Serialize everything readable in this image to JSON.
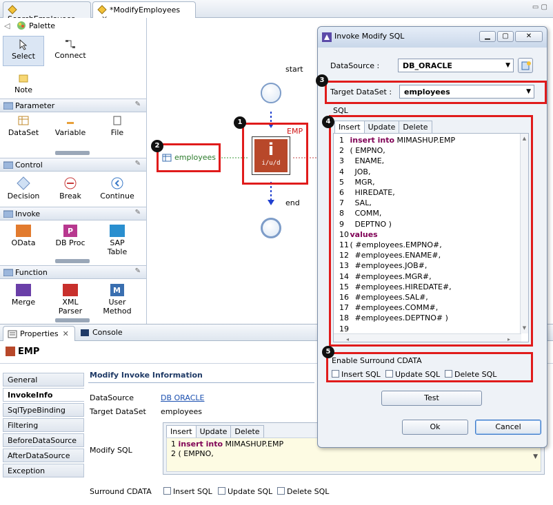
{
  "editor_tabs": [
    {
      "label": "SearchEmployees"
    },
    {
      "label": "*ModifyEmployees"
    }
  ],
  "palette": {
    "title": "Palette",
    "tools": [
      "Select",
      "Connect",
      "Note"
    ],
    "sections": [
      {
        "title": "Parameter",
        "items": [
          "DataSet",
          "Variable",
          "File"
        ]
      },
      {
        "title": "Control",
        "items": [
          "Decision",
          "Break",
          "Continue"
        ]
      },
      {
        "title": "Invoke",
        "items": [
          "OData",
          "DB Proc",
          "SAP\nTable"
        ]
      },
      {
        "title": "Function",
        "items": [
          "Merge",
          "XML\nParser",
          "User\nMethod"
        ]
      }
    ]
  },
  "canvas": {
    "start_label": "start",
    "end_label": "end",
    "node_label": "EMP",
    "node_caption": "i/u/d",
    "dataset_label": "employees",
    "badges": [
      "1",
      "2",
      "3",
      "4",
      "5"
    ]
  },
  "dialog": {
    "title": "Invoke Modify SQL",
    "datasource_label": "DataSource :",
    "datasource_value": "DB_ORACLE",
    "target_label": "Target DataSet :",
    "target_value": "employees",
    "sql_group": "SQL",
    "tabs": [
      "Insert",
      "Update",
      "Delete"
    ],
    "sql_lines": [
      {
        "n": "1",
        "kw": "insert into",
        "text": " MIMASHUP.EMP"
      },
      {
        "n": "2",
        "kw": "",
        "text": "( EMPNO,"
      },
      {
        "n": "3",
        "kw": "",
        "text": "  ENAME,"
      },
      {
        "n": "4",
        "kw": "",
        "text": "  JOB,"
      },
      {
        "n": "5",
        "kw": "",
        "text": "  MGR,"
      },
      {
        "n": "6",
        "kw": "",
        "text": "  HIREDATE,"
      },
      {
        "n": "7",
        "kw": "",
        "text": "  SAL,"
      },
      {
        "n": "8",
        "kw": "",
        "text": "  COMM,"
      },
      {
        "n": "9",
        "kw": "",
        "text": "  DEPTNO )"
      },
      {
        "n": "10",
        "kw": "values",
        "text": ""
      },
      {
        "n": "11",
        "kw": "",
        "text": "( #employees.EMPNO#,"
      },
      {
        "n": "12",
        "kw": "",
        "text": "  #employees.ENAME#,"
      },
      {
        "n": "13",
        "kw": "",
        "text": "  #employees.JOB#,"
      },
      {
        "n": "14",
        "kw": "",
        "text": "  #employees.MGR#,"
      },
      {
        "n": "15",
        "kw": "",
        "text": "  #employees.HIREDATE#,"
      },
      {
        "n": "16",
        "kw": "",
        "text": "  #employees.SAL#,"
      },
      {
        "n": "17",
        "kw": "",
        "text": "  #employees.COMM#,"
      },
      {
        "n": "18",
        "kw": "",
        "text": "  #employees.DEPTNO# )"
      },
      {
        "n": "19",
        "kw": "",
        "text": ""
      }
    ],
    "cdata_group": "Enable Surround CDATA",
    "cdata_options": [
      "Insert SQL",
      "Update SQL",
      "Delete SQL"
    ],
    "test_button": "Test",
    "ok_button": "Ok",
    "cancel_button": "Cancel"
  },
  "properties": {
    "tabs": [
      "Properties",
      "Console"
    ],
    "heading": "EMP",
    "side_tabs": [
      "General",
      "InvokeInfo",
      "SqlTypeBinding",
      "Filtering",
      "BeforeDataSource",
      "AfterDataSource",
      "Exception"
    ],
    "section_title": "Modify Invoke Information",
    "datasource_label": "DataSource",
    "datasource_value": "DB ORACLE",
    "target_label": "Target DataSet",
    "target_value": "employees",
    "modify_sql_label": "Modify SQL",
    "sql_tabs": [
      "Insert",
      "Update",
      "Delete"
    ],
    "sql_line1_kw": "insert into",
    "sql_line1_text": " MIMASHUP.EMP",
    "sql_line2_text": "( EMPNO,",
    "cdata_label": "Surround CDATA",
    "cdata_options": [
      "Insert SQL",
      "Update SQL",
      "Delete SQL"
    ]
  },
  "colors": {
    "highlight": "#e01b1b",
    "keyword": "#7f0055",
    "link": "#1a4fb0"
  }
}
